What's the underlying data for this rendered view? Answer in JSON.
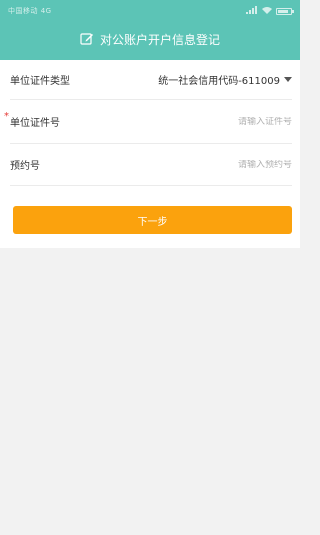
{
  "status_bar": {
    "left_text": "中国移动 4G",
    "signal_text": "4G",
    "wifi_text": "WiFi"
  },
  "header": {
    "title": "对公账户开户信息登记",
    "icon": "edit-icon",
    "bg_color": "#5cc4b6"
  },
  "form": {
    "cert_type": {
      "label": "单位证件类型",
      "value": "统一社会信用代码-611009"
    },
    "cert_no": {
      "label": "单位证件号",
      "required_mark": "*",
      "placeholder": "请输入证件号",
      "value": ""
    },
    "reservation_no": {
      "label": "预约号",
      "placeholder": "请输入预约号",
      "value": ""
    }
  },
  "next_button": {
    "label": "下一步",
    "color": "#fba20d"
  }
}
